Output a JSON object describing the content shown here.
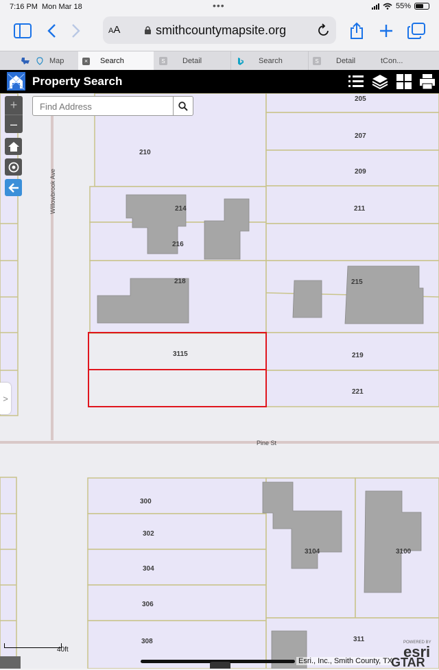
{
  "status_bar": {
    "time": "7:16 PM",
    "date": "Mon Mar 18",
    "battery": "55%",
    "battery_level": 0.55
  },
  "browser": {
    "url": "smithcountymapsite.org",
    "text_size": "AA",
    "tabs": [
      {
        "label": "Map",
        "active": false
      },
      {
        "label": "Search",
        "active": true
      },
      {
        "label": "Detail",
        "active": false,
        "favicon": "S"
      },
      {
        "label": "Search",
        "active": false
      },
      {
        "label": "Detail",
        "active": false,
        "favicon": "S"
      },
      {
        "label": "tCon...",
        "active": false
      }
    ]
  },
  "app": {
    "title": "Property Search"
  },
  "search": {
    "placeholder": "Find Address",
    "value": ""
  },
  "zoom": {
    "in": "+",
    "out": "–"
  },
  "map": {
    "streets": {
      "vertical": "Willowbrook Ave",
      "horizontal": "Pine St"
    },
    "parcel_labels": [
      "205",
      "207",
      "209",
      "210",
      "211",
      "214",
      "216",
      "218",
      "215",
      "3115",
      "219",
      "221",
      "300",
      "302",
      "304",
      "306",
      "308",
      "3104",
      "3100",
      "311"
    ],
    "selected_parcels": [
      "3115"
    ],
    "scale": "40ft",
    "attribution": "Esri., Inc., Smith County, TX",
    "esri_tagline": "POWERED BY",
    "esri": "esri",
    "watermark": "GTAR"
  },
  "colors": {
    "accent": "#1a73e8",
    "parcel_fill": "#e9e6f8",
    "parcel_line": "#c9c48a",
    "building": "#a6a6a6",
    "selection": "#e0151d",
    "appbar": "#000000"
  }
}
